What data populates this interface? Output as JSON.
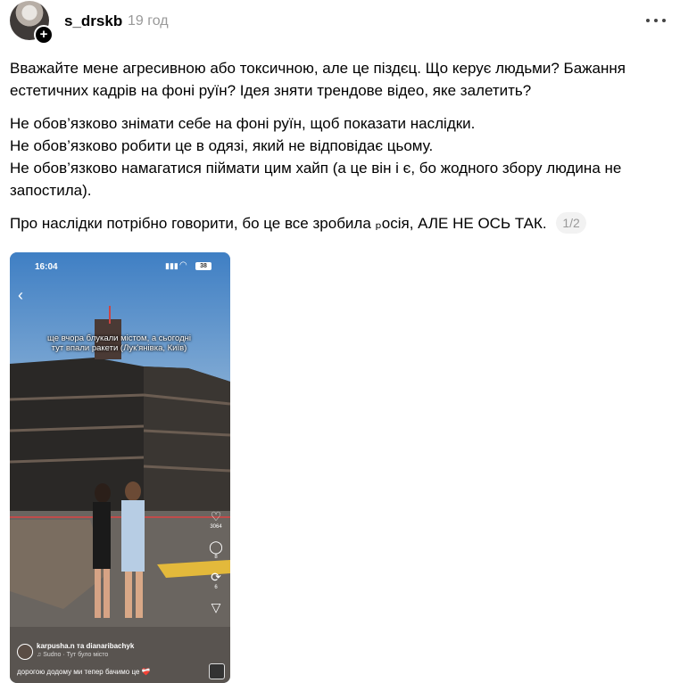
{
  "post": {
    "username": "s_drskb",
    "timestamp": "19 год",
    "paragraphs": [
      "Вважайте мене агресивною або токсичною, але це піздєц. Що керує людьми? Бажання естетичних кадрів на фоні руїн? Ідея зняти трендове відео, яке залетить?",
      "Не обов’язково знімати себе на фоні руїн, щоб показати наслідки.",
      "Не обов’язково робити це в одязі, який не відповідає цьому.",
      "Не обов’язково намагатися піймати цим хайп (а це він і є, бо жодного збору людина не запостила).",
      "Про наслідки потрібно говорити, бо це все зробила ₚосія, АЛЕ НЕ ОСЬ ТАК."
    ],
    "page_indicator": "1/2"
  },
  "media": {
    "status_time": "16:04",
    "battery": "38",
    "caption": "ще вчора блукали містом, а сьогодні тут впали ракети (Лук'янівка, Київ)",
    "like_count": "3064",
    "comment_count": "8",
    "repost_count": "6",
    "share_count": "",
    "authors": "karpusha.n та dianaribachyk",
    "music": "♫ Sudno · Тут було місто",
    "bottom_text": "дорогою додому ми тепер бачимо це",
    "bottom_emoji": "❤️‍🩹"
  },
  "icons": {
    "avatar_add": "plus-icon",
    "more": "more-dots-icon",
    "back": "chevron-left-icon",
    "like": "heart-icon",
    "comment": "comment-icon",
    "repost": "repost-icon",
    "share": "share-icon"
  }
}
